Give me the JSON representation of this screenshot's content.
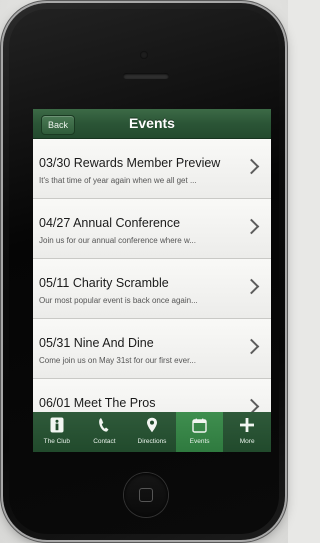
{
  "navbar": {
    "back_label": "Back",
    "title": "Events"
  },
  "events": [
    {
      "title": "03/30 Rewards Member Preview",
      "desc": "It's that time of year again when we all get ..."
    },
    {
      "title": "04/27 Annual Conference",
      "desc": "Join us for our annual conference where w..."
    },
    {
      "title": "05/11 Charity Scramble",
      "desc": "Our most popular event is back once again..."
    },
    {
      "title": "05/31 Nine And Dine",
      "desc": "Come join us on May 31st for our first ever..."
    },
    {
      "title": "06/01 Meet The Pros",
      "desc": ""
    }
  ],
  "tabs": [
    {
      "label": "The Club",
      "icon": "info-icon"
    },
    {
      "label": "Contact",
      "icon": "phone-icon"
    },
    {
      "label": "Directions",
      "icon": "location-pin-icon"
    },
    {
      "label": "Events",
      "icon": "calendar-icon",
      "active": true
    },
    {
      "label": "More",
      "icon": "plus-icon"
    }
  ],
  "colors": {
    "navbar": "#2b5536",
    "tabbar": "#214a2c",
    "active_tab": "#3f8f4f"
  }
}
